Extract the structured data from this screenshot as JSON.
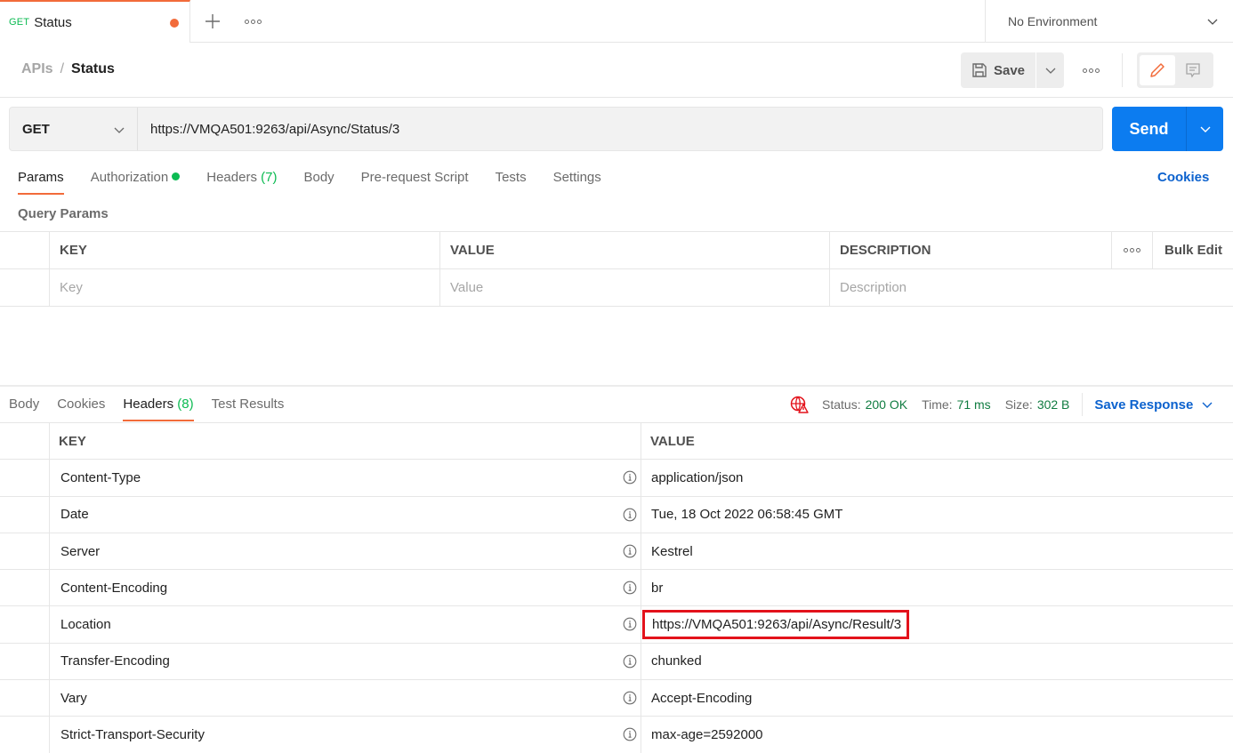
{
  "tabbar": {
    "tab": {
      "method": "GET",
      "title": "Status",
      "unsaved": true
    },
    "new_tab_icon": "plus-icon",
    "more_icon": "more-horizontal-icon",
    "environment": {
      "selected": "No Environment"
    }
  },
  "header": {
    "breadcrumb": {
      "parent": "APIs",
      "separator": "/",
      "current": "Status"
    },
    "save_label": "Save",
    "icons": [
      "save-icon",
      "chevron-down-icon",
      "more-horizontal-icon",
      "pencil-icon",
      "comment-icon"
    ]
  },
  "request": {
    "method": "GET",
    "url": "https://VMQA501:9263/api/Async/Status/3",
    "send_label": "Send",
    "tabs": [
      {
        "label": "Params",
        "active": true
      },
      {
        "label": "Authorization",
        "indicator": true
      },
      {
        "label": "Headers",
        "count": "(7)"
      },
      {
        "label": "Body"
      },
      {
        "label": "Pre-request Script"
      },
      {
        "label": "Tests"
      },
      {
        "label": "Settings"
      }
    ],
    "cookies_label": "Cookies",
    "query_params_label": "Query Params",
    "params_table": {
      "columns": [
        "KEY",
        "VALUE",
        "DESCRIPTION"
      ],
      "bulk_edit_label": "Bulk Edit",
      "placeholders": {
        "key": "Key",
        "value": "Value",
        "description": "Description"
      }
    }
  },
  "response": {
    "tabs": [
      {
        "label": "Body"
      },
      {
        "label": "Cookies"
      },
      {
        "label": "Headers",
        "count": "(8)",
        "active": true
      },
      {
        "label": "Test Results"
      }
    ],
    "status_label": "Status:",
    "status_value": "200 OK",
    "time_label": "Time:",
    "time_value": "71 ms",
    "size_label": "Size:",
    "size_value": "302 B",
    "save_response_label": "Save Response",
    "status_color": "#107c41",
    "headers_table": {
      "columns": [
        "KEY",
        "VALUE"
      ],
      "rows": [
        {
          "key": "Content-Type",
          "value": "application/json"
        },
        {
          "key": "Date",
          "value": "Tue, 18 Oct 2022 06:58:45 GMT"
        },
        {
          "key": "Server",
          "value": "Kestrel"
        },
        {
          "key": "Content-Encoding",
          "value": "br"
        },
        {
          "key": "Location",
          "value": "https://VMQA501:9263/api/Async/Result/3",
          "highlighted": true
        },
        {
          "key": "Transfer-Encoding",
          "value": "chunked"
        },
        {
          "key": "Vary",
          "value": "Accept-Encoding"
        },
        {
          "key": "Strict-Transport-Security",
          "value": "max-age=2592000"
        }
      ]
    }
  },
  "colors": {
    "accent": "#f26b3a",
    "primary": "#0c7cf0",
    "success": "#0cbb52",
    "link": "#0c62ce",
    "highlight_border": "#e3121b"
  }
}
